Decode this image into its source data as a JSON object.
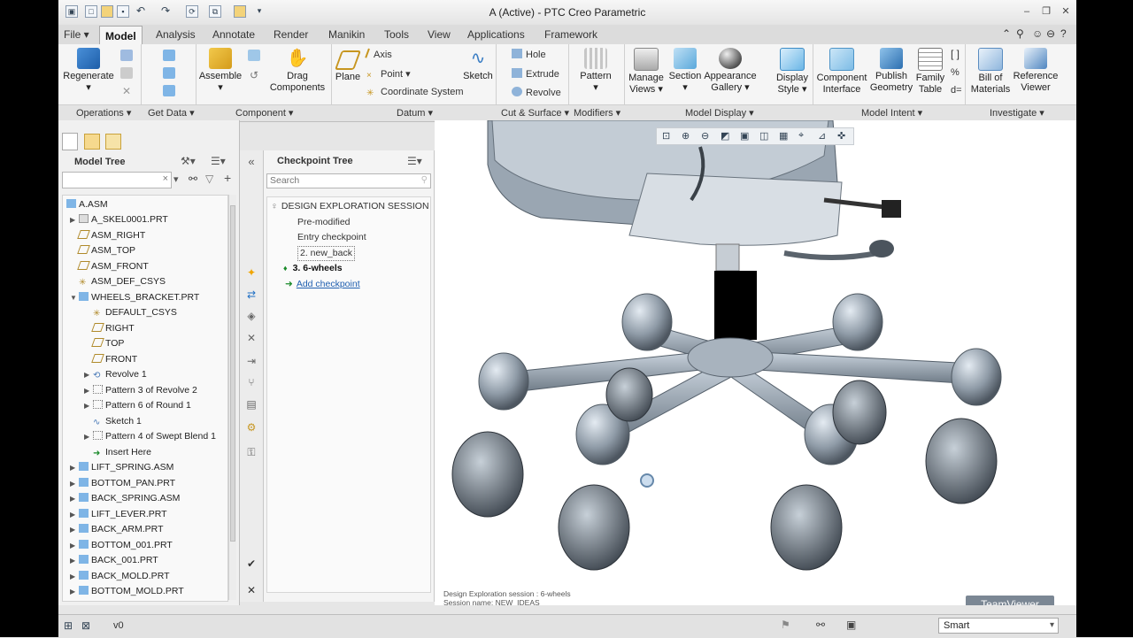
{
  "window": {
    "title": "A (Active) - PTC Creo Parametric"
  },
  "menu": {
    "tabs": [
      "File ▾",
      "Model",
      "Analysis",
      "Annotate",
      "Render",
      "Manikin",
      "Tools",
      "View",
      "Applications",
      "Framework"
    ],
    "active_tab": "Model"
  },
  "ribbon": {
    "regenerate": "Regenerate",
    "assemble": "Assemble",
    "drag_components": [
      "Drag",
      "Components"
    ],
    "plane": "Plane",
    "axis": "Axis",
    "point": "Point",
    "coordinate_system": "Coordinate System",
    "sketch": "Sketch",
    "hole": "Hole",
    "extrude": "Extrude",
    "revolve": "Revolve",
    "pattern": "Pattern",
    "manage_views": [
      "Manage",
      "Views"
    ],
    "section": "Section",
    "appearance_gallery": [
      "Appearance",
      "Gallery"
    ],
    "display_style": [
      "Display",
      "Style"
    ],
    "component_interface": [
      "Component",
      "Interface"
    ],
    "publish_geometry": [
      "Publish",
      "Geometry"
    ],
    "family_table": [
      "Family",
      "Table"
    ],
    "bill_of_materials": [
      "Bill of",
      "Materials"
    ],
    "reference_viewer": [
      "Reference",
      "Viewer"
    ],
    "groups": [
      "Operations ▾",
      "Get Data ▾",
      "Component ▾",
      "Datum ▾",
      "Cut & Surface ▾",
      "Modifiers ▾",
      "Model Display ▾",
      "Model Intent ▾",
      "Investigate ▾"
    ]
  },
  "model_tree": {
    "title": "Model Tree",
    "items": [
      {
        "label": "A.ASM",
        "type": "asm"
      },
      {
        "label": "A_SKEL0001.PRT",
        "type": "prt"
      },
      {
        "label": "ASM_RIGHT",
        "type": "plane"
      },
      {
        "label": "ASM_TOP",
        "type": "plane"
      },
      {
        "label": "ASM_FRONT",
        "type": "plane"
      },
      {
        "label": "ASM_DEF_CSYS",
        "type": "csys"
      },
      {
        "label": "WHEELS_BRACKET.PRT",
        "type": "prt"
      },
      {
        "label": "DEFAULT_CSYS",
        "type": "csys"
      },
      {
        "label": "RIGHT",
        "type": "plane"
      },
      {
        "label": "TOP",
        "type": "plane"
      },
      {
        "label": "FRONT",
        "type": "plane"
      },
      {
        "label": "Revolve 1",
        "type": "feat"
      },
      {
        "label": "Pattern 3 of Revolve 2",
        "type": "pattern"
      },
      {
        "label": "Pattern 6 of Round 1",
        "type": "pattern"
      },
      {
        "label": "Sketch 1",
        "type": "sketch"
      },
      {
        "label": "Pattern 4 of Swept Blend 1",
        "type": "pattern"
      },
      {
        "label": "Insert Here",
        "type": "insert"
      },
      {
        "label": "LIFT_SPRING.ASM",
        "type": "asm"
      },
      {
        "label": "BOTTOM_PAN.PRT",
        "type": "prt"
      },
      {
        "label": "BACK_SPRING.ASM",
        "type": "asm"
      },
      {
        "label": "LIFT_LEVER.PRT",
        "type": "prt"
      },
      {
        "label": "BACK_ARM.PRT",
        "type": "prt"
      },
      {
        "label": "BOTTOM_001.PRT",
        "type": "prt"
      },
      {
        "label": "BACK_001.PRT",
        "type": "prt"
      },
      {
        "label": "BACK_MOLD.PRT",
        "type": "prt"
      },
      {
        "label": "BOTTOM_MOLD.PRT",
        "type": "prt"
      }
    ]
  },
  "checkpoint_tree": {
    "title": "Checkpoint Tree",
    "search_placeholder": "Search",
    "session": "DESIGN EXPLORATION SESSION",
    "items": [
      "Pre-modified",
      "Entry checkpoint",
      "2. new_back",
      "3. 6-wheels"
    ],
    "add": "Add checkpoint"
  },
  "viewport": {
    "info_line1": "Design Exploration session : 6-wheels",
    "info_line2": "Session name: NEW_IDEAS",
    "watermark": "TeamViewer"
  },
  "statusbar": {
    "text": "v0",
    "filter": "Smart"
  }
}
